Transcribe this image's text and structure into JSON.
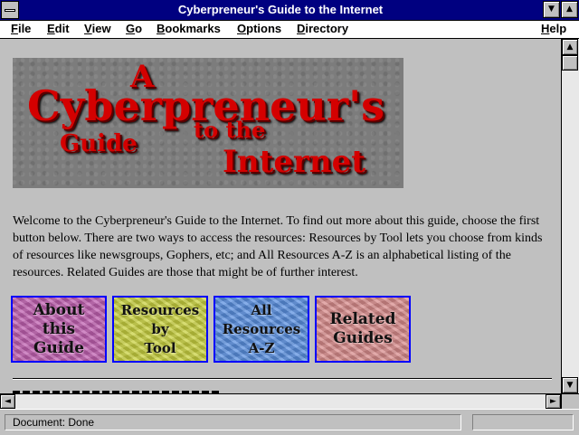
{
  "window": {
    "title": "Cyberpreneur's Guide to the Internet"
  },
  "menu": {
    "file": {
      "first": "F",
      "rest": "ile"
    },
    "edit": {
      "first": "E",
      "rest": "dit"
    },
    "view": {
      "first": "V",
      "rest": "iew"
    },
    "go": {
      "first": "G",
      "rest": "o"
    },
    "bookmarks": {
      "first": "B",
      "rest": "ookmarks"
    },
    "options": {
      "first": "O",
      "rest": "ptions"
    },
    "directory": {
      "first": "D",
      "rest": "irectory"
    },
    "help": {
      "first": "H",
      "rest": "elp"
    }
  },
  "logo": {
    "line_a": "A",
    "line_cyberpreneurs": "Cyberpreneur's",
    "line_guide": "Guide",
    "line_to_the": "to the",
    "line_internet": "Internet"
  },
  "intro_text": "Welcome to the Cyberpreneur's Guide to the Internet. To find out more about this guide, choose the first button below. There are two ways to access the resources: Resources by Tool lets you choose from kinds of resources like newsgroups, Gophers, etc; and All Resources A-Z is an alphabetical listing of the resources. Related Guides are those that might be of further interest.",
  "nav_buttons": [
    {
      "lines": [
        "About",
        "this",
        "Guide"
      ],
      "color": "#c060b0"
    },
    {
      "lines": [
        "Resources",
        "by",
        "Tool"
      ],
      "color": "#c8d040"
    },
    {
      "lines": [
        "All",
        "Resources",
        "A-Z"
      ],
      "color": "#5a90e0"
    },
    {
      "lines": [
        "Related",
        "Guides"
      ],
      "color": "#d88c8c"
    }
  ],
  "status": {
    "text": "Document: Done"
  },
  "icons": {
    "minimize": "▼",
    "maximize": "▲",
    "scroll_up": "▲",
    "scroll_down": "▼",
    "scroll_left": "◄",
    "scroll_right": "►"
  }
}
